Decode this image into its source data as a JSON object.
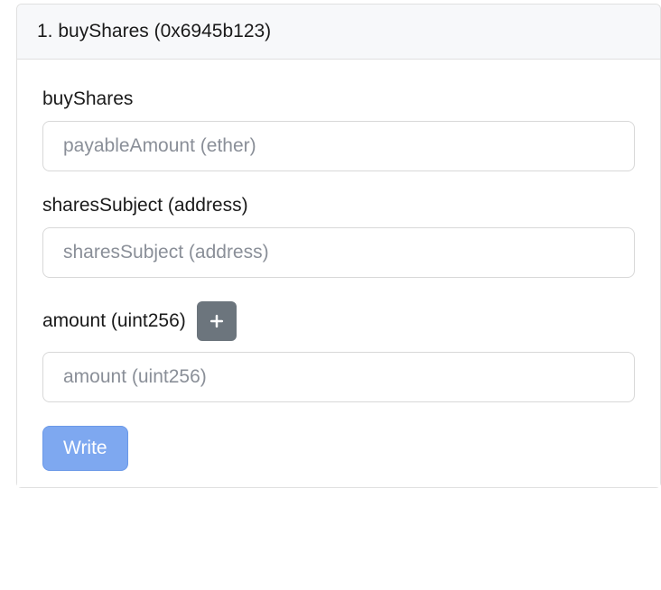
{
  "header": {
    "title": "1. buyShares (0x6945b123)"
  },
  "fields": [
    {
      "label": "buyShares",
      "placeholder": "payableAmount (ether)",
      "hasAdd": false
    },
    {
      "label": "sharesSubject (address)",
      "placeholder": "sharesSubject (address)",
      "hasAdd": false
    },
    {
      "label": "amount (uint256)",
      "placeholder": "amount (uint256)",
      "hasAdd": true
    }
  ],
  "actions": {
    "writeLabel": "Write"
  }
}
